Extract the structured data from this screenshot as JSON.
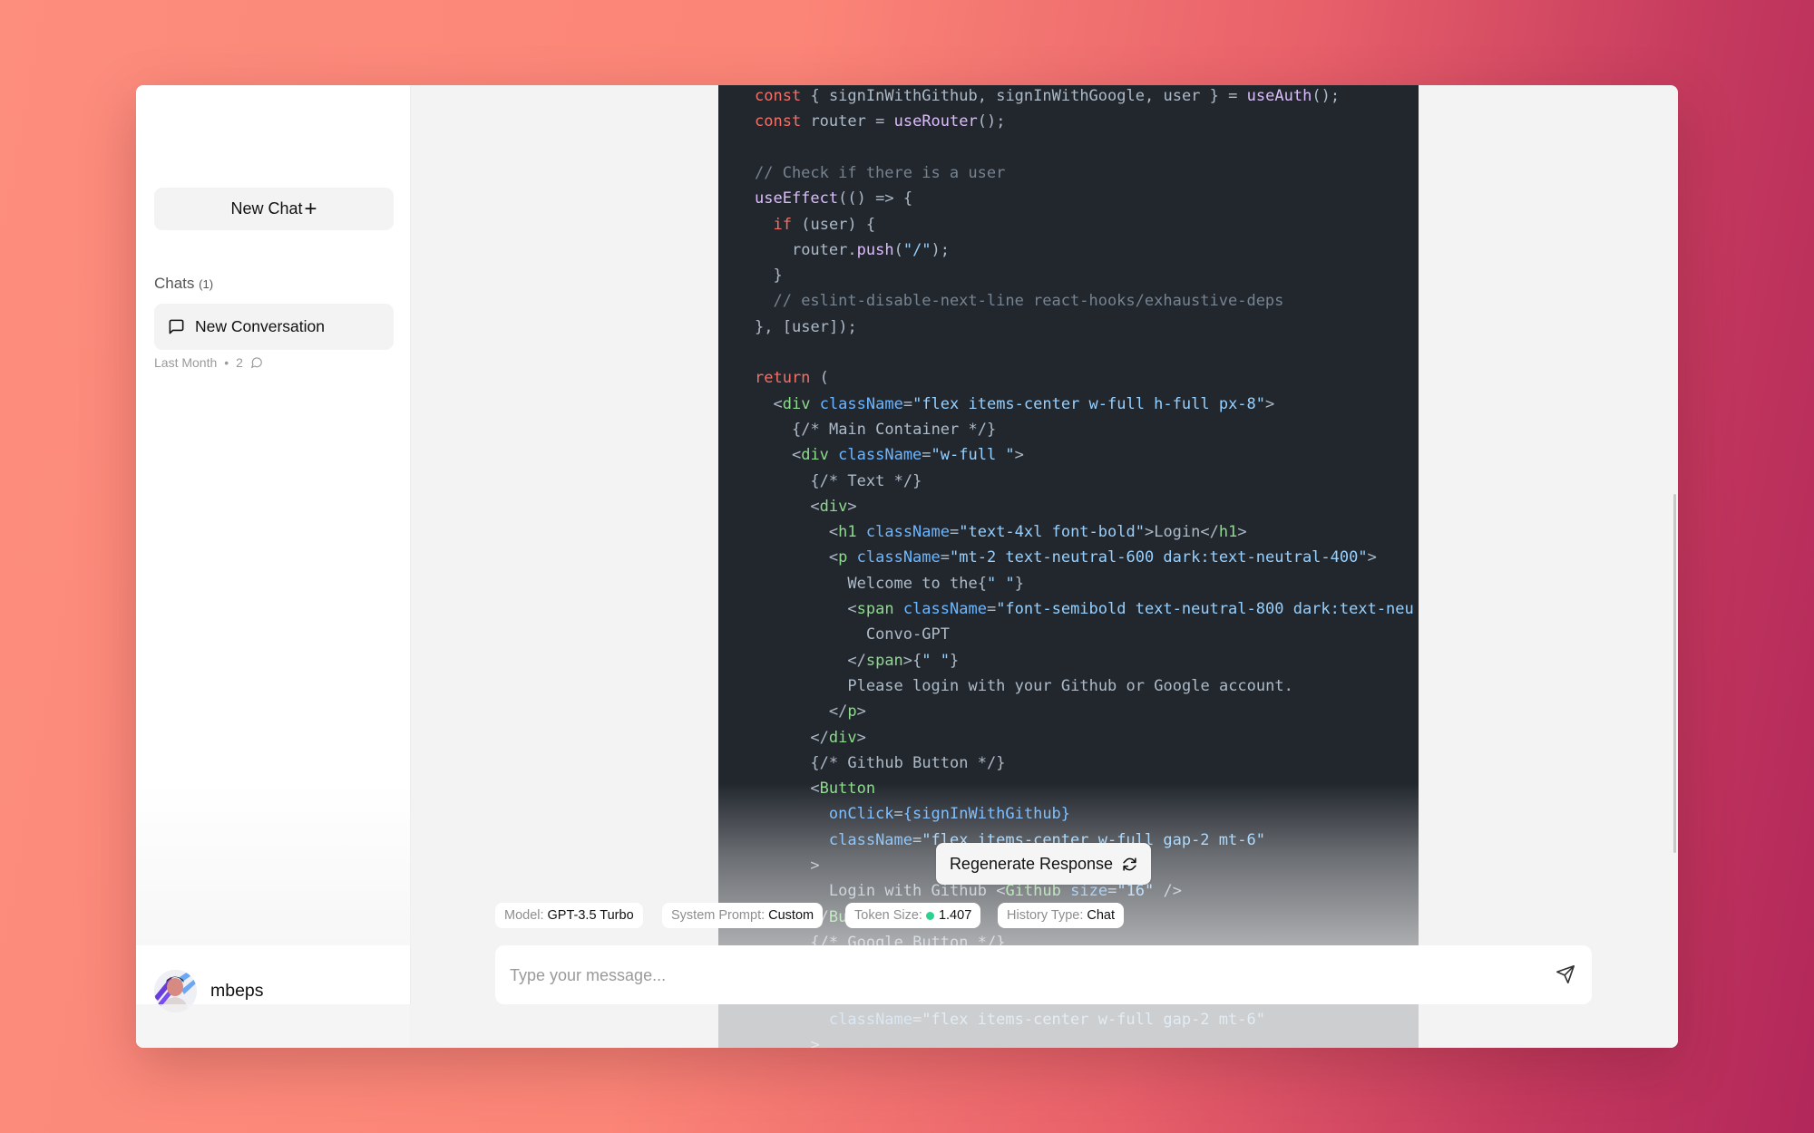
{
  "sidebar": {
    "new_chat_label": "New Chat",
    "new_chat_icon": "plus-icon",
    "chats_label": "Chats",
    "chats_count": "(1)",
    "conversations": [
      {
        "title": "New Conversation",
        "icon": "message-square-icon",
        "time": "Last Month",
        "message_count": "2"
      }
    ],
    "user": {
      "name": "mbeps"
    }
  },
  "code": {
    "colors": {
      "background": "#22272e",
      "keyword": "#f47067",
      "function": "#dcbdfb",
      "comment": "#768390",
      "string": "#96d0ff",
      "attribute": "#6cb6ff",
      "tag": "#8ddb8c",
      "text": "#adbac7"
    },
    "lines": [
      "const { signInWithGithub, signInWithGoogle, user } = useAuth();",
      "const router = useRouter();",
      "",
      "// Check if there is a user",
      "useEffect(() => {",
      "  if (user) {",
      "    router.push(\"/\");",
      "  }",
      "  // eslint-disable-next-line react-hooks/exhaustive-deps",
      "}, [user]);",
      "",
      "return (",
      "  <div className=\"flex items-center w-full h-full px-8\">",
      "    {/* Main Container */}",
      "    <div className=\"w-full \">",
      "      {/* Text */}",
      "      <div>",
      "        <h1 className=\"text-4xl font-bold\">Login</h1>",
      "        <p className=\"mt-2 text-neutral-600 dark:text-neutral-400\">",
      "          Welcome to the{\" \"}",
      "          <span className=\"font-semibold text-neutral-800 dark:text-neu",
      "            Convo-GPT",
      "          </span>{\" \"}",
      "          Please login with your Github or Google account.",
      "        </p>",
      "      </div>",
      "      {/* Github Button */}",
      "      <Button",
      "        onClick={signInWithGithub}",
      "        className=\"flex items-center w-full gap-2 mt-6\"",
      "      >",
      "        Login with Github <Github size=\"16\" />",
      "      </Button>",
      "      {/* Google Button */}",
      "",
      "",
      "        className=\"flex items-center w-full gap-2 mt-6\"",
      "      >"
    ]
  },
  "main": {
    "regenerate_label": "Regenerate Response",
    "regenerate_icon": "refresh-icon",
    "chips": {
      "model": {
        "label": "Model:",
        "value": "GPT-3.5 Turbo"
      },
      "system_prompt": {
        "label": "System Prompt:",
        "value": "Custom"
      },
      "token_size": {
        "label": "Token Size:",
        "value": "1.407",
        "status_color": "#2bd18f"
      },
      "history_type": {
        "label": "History Type:",
        "value": "Chat"
      }
    },
    "input": {
      "placeholder": "Type your message...",
      "value": "",
      "send_icon": "send-icon"
    }
  }
}
